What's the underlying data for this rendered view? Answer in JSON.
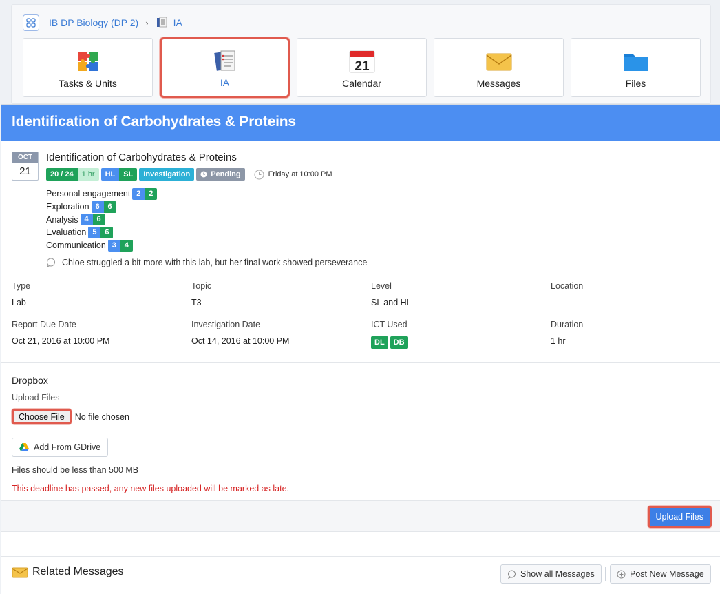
{
  "breadcrumb": {
    "course": "IB DP Biology (DP 2)",
    "section": "IA"
  },
  "tiles": [
    {
      "label": "Tasks & Units",
      "icon": "puzzle-icon"
    },
    {
      "label": "IA",
      "icon": "notebook-icon"
    },
    {
      "label": "Calendar",
      "icon": "calendar-icon",
      "day": "21"
    },
    {
      "label": "Messages",
      "icon": "envelope-icon"
    },
    {
      "label": "Files",
      "icon": "folder-icon"
    }
  ],
  "banner": {
    "title": "Identification of Carbohydrates & Proteins"
  },
  "task": {
    "month": "OCT",
    "day": "21",
    "title": "Identification of Carbohydrates & Proteins",
    "score": "20 / 24",
    "duration_badge": "1 hr",
    "level_hl": "HL",
    "level_sl": "SL",
    "category": "Investigation",
    "status": "Pending",
    "due_text": "Friday at 10:00 PM"
  },
  "criteria": [
    {
      "label": "Personal engagement",
      "score": "2",
      "max": "2"
    },
    {
      "label": "Exploration",
      "score": "6",
      "max": "6"
    },
    {
      "label": "Analysis",
      "score": "4",
      "max": "6"
    },
    {
      "label": "Evaluation",
      "score": "5",
      "max": "6"
    },
    {
      "label": "Communication",
      "score": "3",
      "max": "4"
    }
  ],
  "comment": "Chloe struggled a bit more with this lab, but her final work showed perseverance",
  "meta": {
    "type_label": "Type",
    "type_value": "Lab",
    "topic_label": "Topic",
    "topic_value": "T3",
    "level_label": "Level",
    "level_value": "SL and HL",
    "location_label": "Location",
    "location_value": "–",
    "report_due_label": "Report Due Date",
    "report_due_value": "Oct 21, 2016 at 10:00 PM",
    "investigation_label": "Investigation Date",
    "investigation_value": "Oct 14, 2016 at 10:00 PM",
    "ict_label": "ICT Used",
    "ict_values": [
      "DL",
      "DB"
    ],
    "duration_label": "Duration",
    "duration_value": "1 hr"
  },
  "dropbox": {
    "heading": "Dropbox",
    "upload_label": "Upload Files",
    "choose_file": "Choose File",
    "no_file": "No file chosen",
    "gdrive": "Add From GDrive",
    "size_note": "Files should be less than 500 MB",
    "late_warning": "This deadline has passed, any new files uploaded will be marked as late.",
    "upload_button": "Upload Files"
  },
  "related": {
    "title": "Related Messages",
    "show_all": "Show all Messages",
    "post_new": "Post New Message"
  },
  "colors": {
    "banner": "#4c8ef2",
    "green": "#1fa25a",
    "blue": "#4b8ff0",
    "highlight": "#e05a4e",
    "late": "#d62424"
  }
}
